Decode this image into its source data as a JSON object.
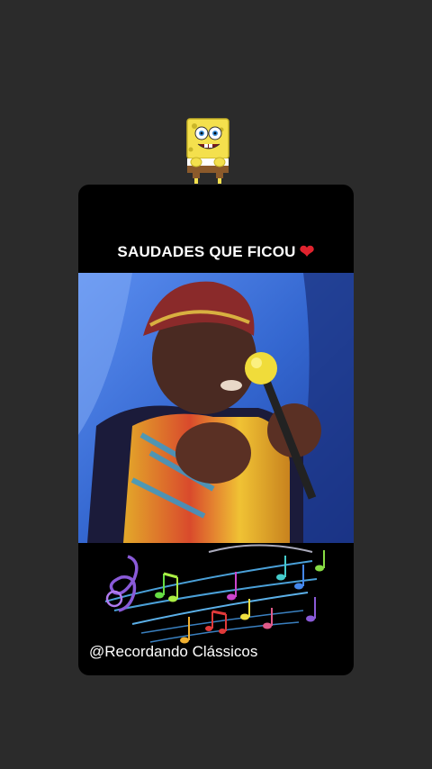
{
  "story": {
    "headline": "SAUDADES QUE FICOU",
    "heart_icon": "red-heart-emoji",
    "handle": "@Recordando Clássicos",
    "sticker_icon": "spongebob-sticker"
  },
  "colors": {
    "background": "#2b2b2b",
    "card": "#000000",
    "heart": "#e0232e",
    "video_backdrop": "#3b72d8"
  }
}
